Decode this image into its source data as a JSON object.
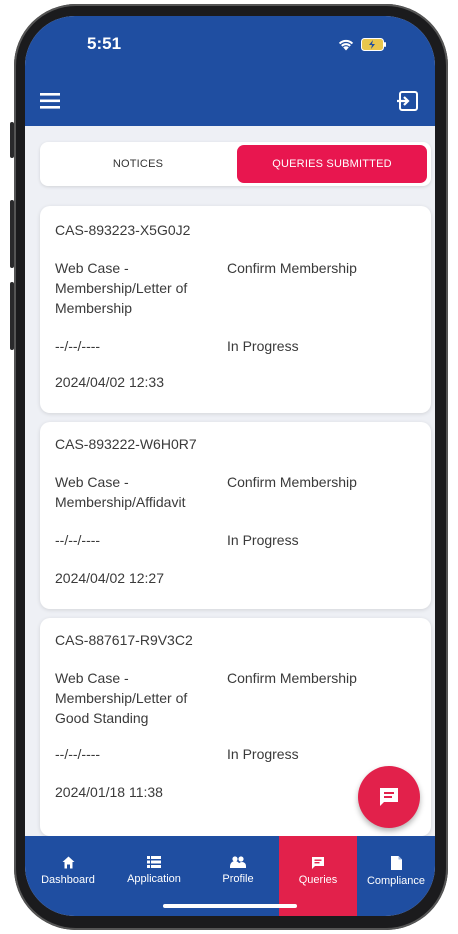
{
  "status_bar": {
    "time": "5:51"
  },
  "tabs": [
    {
      "label": "NOTICES"
    },
    {
      "label": "QUERIES SUBMITTED"
    }
  ],
  "cases": [
    {
      "id": "CAS-893223-X5G0J2",
      "type": "Web Case - Membership/Letter of Membership",
      "category": "Confirm Membership",
      "due": "--/--/----",
      "status": "In Progress",
      "timestamp": "2024/04/02 12:33"
    },
    {
      "id": "CAS-893222-W6H0R7",
      "type": "Web Case - Membership/Affidavit",
      "category": "Confirm Membership",
      "due": "--/--/----",
      "status": "In Progress",
      "timestamp": "2024/04/02 12:27"
    },
    {
      "id": "CAS-887617-R9V3C2",
      "type": "Web Case - Membership/Letter of Good Standing",
      "category": "Confirm Membership",
      "due": "--/--/----",
      "status": "In Progress",
      "timestamp": "2024/01/18 11:38"
    }
  ],
  "nav": [
    {
      "label": "Dashboard",
      "icon": "home-icon"
    },
    {
      "label": "Application",
      "icon": "list-icon"
    },
    {
      "label": "Profile",
      "icon": "people-icon"
    },
    {
      "label": "Queries",
      "icon": "chat-icon"
    },
    {
      "label": "Compliance",
      "icon": "document-icon"
    }
  ],
  "colors": {
    "primary": "#1f4ea1",
    "accent": "#e8164f",
    "background": "#eef0f5"
  }
}
